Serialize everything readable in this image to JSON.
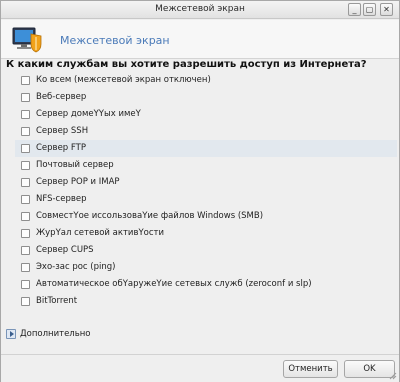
{
  "window": {
    "title": "Межсетевой экран",
    "controls": {
      "minimize": "_",
      "maximize": "▢",
      "close": "✕"
    }
  },
  "header": {
    "title": "Межсетевой экран",
    "icon": "firewall-monitor-icon"
  },
  "question": "К каким службам вы хотите разрешить доступ из Интернета?",
  "services": [
    {
      "label": "Ко всем (межсетевой экран отключен)",
      "checked": false,
      "highlighted": false
    },
    {
      "label": "Веб-сервер",
      "checked": false,
      "highlighted": false
    },
    {
      "label": "Сервер домеYYых имеY",
      "checked": false,
      "highlighted": false
    },
    {
      "label": "Сервер SSH",
      "checked": false,
      "highlighted": false
    },
    {
      "label": "Сервер FTP",
      "checked": false,
      "highlighted": true
    },
    {
      "label": "Почтовый сервер",
      "checked": false,
      "highlighted": false
    },
    {
      "label": "Сервер POP и IMAP",
      "checked": false,
      "highlighted": false
    },
    {
      "label": "NFS-сервер",
      "checked": false,
      "highlighted": false
    },
    {
      "label": "СовместYое иссользоваYие файлов Windows (SMB)",
      "checked": false,
      "highlighted": false
    },
    {
      "label": "ЖурYал сетевой активYости",
      "checked": false,
      "highlighted": false
    },
    {
      "label": "Сервер CUPS",
      "checked": false,
      "highlighted": false
    },
    {
      "label": "Эхо-зас рос (ping)",
      "checked": false,
      "highlighted": false
    },
    {
      "label": "Автоматическое обYаружеYие сетевых служб (zeroconf и slp)",
      "checked": false,
      "highlighted": false
    },
    {
      "label": "BitTorrent",
      "checked": false,
      "highlighted": false
    }
  ],
  "advanced": {
    "label": "Дополнительно",
    "expanded": false
  },
  "footer": {
    "cancel_label": "Отменить",
    "ok_label": "OK"
  },
  "colors": {
    "header_title": "#4a7ab8",
    "highlight_row": "#e2e8ee"
  }
}
